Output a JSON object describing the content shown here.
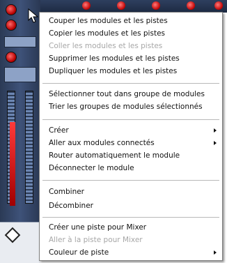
{
  "context_menu": {
    "groups": [
      [
        {
          "label": "Couper les modules et les pistes",
          "enabled": true
        },
        {
          "label": "Copier les modules et les pistes",
          "enabled": true
        },
        {
          "label": "Coller les modules et les pistes",
          "enabled": false
        },
        {
          "label": "Supprimer les modules et les pistes",
          "enabled": true
        },
        {
          "label": "Dupliquer les modules et les pistes",
          "enabled": true
        }
      ],
      [
        {
          "label": "Sélectionner tout dans groupe de modules",
          "enabled": true
        },
        {
          "label": "Trier les groupes de modules sélectionnés",
          "enabled": true
        }
      ],
      [
        {
          "label": "Créer",
          "enabled": true,
          "submenu": true
        },
        {
          "label": "Aller aux modules connectés",
          "enabled": true,
          "submenu": true
        },
        {
          "label": "Router automatiquement le module",
          "enabled": true
        },
        {
          "label": "Déconnecter le module",
          "enabled": true
        }
      ],
      [
        {
          "label": "Combiner",
          "enabled": true
        },
        {
          "label": "Décombiner",
          "enabled": true
        }
      ],
      [
        {
          "label": "Créer une piste pour Mixer",
          "enabled": true
        },
        {
          "label": "Aller à la piste pour Mixer",
          "enabled": false
        },
        {
          "label": "Couleur de piste",
          "enabled": true,
          "submenu": true
        }
      ]
    ]
  },
  "colors": {
    "menu_background": "#ffffff",
    "disabled_text": "#a7a7a7",
    "app_background": "#3e5279",
    "knob_red": "#c00000"
  }
}
